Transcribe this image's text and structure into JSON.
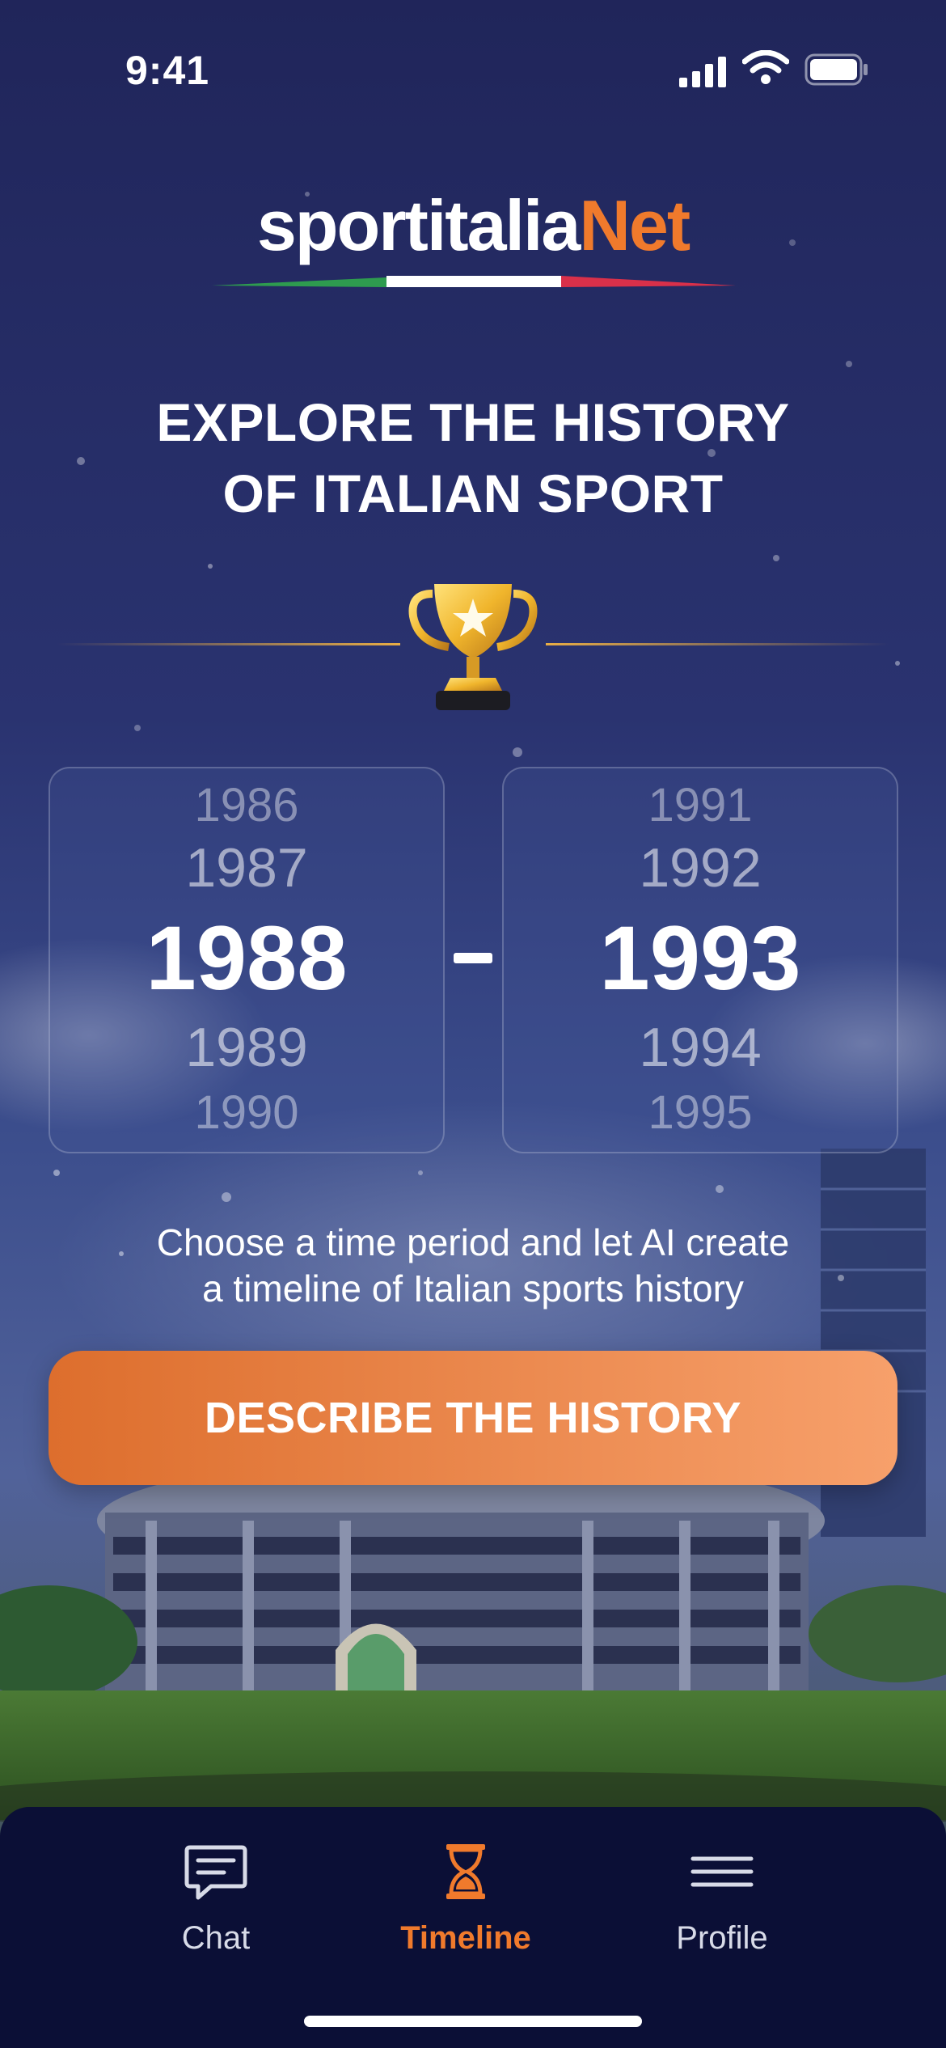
{
  "status_bar": {
    "time": "9:41"
  },
  "brand": {
    "name_main": "sportitalia",
    "name_accent": "Net",
    "accent_color": "#f07a2c"
  },
  "headline": {
    "line1": "EXPLORE THE HISTORY",
    "line2": "OF ITALIAN SPORT"
  },
  "icons": {
    "trophy": "trophy-icon"
  },
  "start_picker": {
    "above2": "1986",
    "above1": "1987",
    "selected": "1988",
    "below1": "1989",
    "below2": "1990"
  },
  "separator": "-",
  "end_picker": {
    "above2": "1991",
    "above1": "1992",
    "selected": "1993",
    "below1": "1994",
    "below2": "1995"
  },
  "subtitle": {
    "line1": "Choose a time period and let AI create",
    "line2": "a timeline of Italian sports history"
  },
  "cta": {
    "label": "DESCRIBE THE HISTORY"
  },
  "tabbar": {
    "tabs": [
      {
        "label": "Chat",
        "icon": "chat-bubble-icon",
        "active": false
      },
      {
        "label": "Timeline",
        "icon": "hourglass-icon",
        "active": true
      },
      {
        "label": "Profile",
        "icon": "menu-lines-icon",
        "active": false
      }
    ]
  }
}
